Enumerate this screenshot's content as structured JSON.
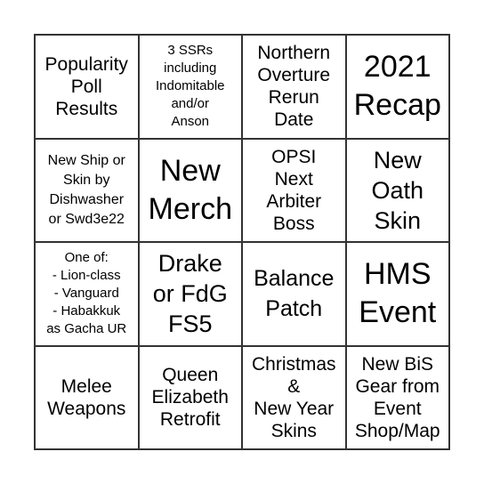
{
  "cells": [
    {
      "text": "Popularity\nPoll\nResults",
      "size": "m"
    },
    {
      "text": "3 SSRs\nincluding\nIndomitable\nand/or\nAnson",
      "size": "s"
    },
    {
      "text": "Northern\nOverture\nRerun\nDate",
      "size": "m"
    },
    {
      "text": "2021\nRecap",
      "size": "xl"
    },
    {
      "text": "New Ship or\nSkin by\nDishwasher\nor Swd3e22",
      "size": "s2"
    },
    {
      "text": "New\nMerch",
      "size": "xl"
    },
    {
      "text": "OPSI\nNext\nArbiter\nBoss",
      "size": "m"
    },
    {
      "text": "New\nOath\nSkin",
      "size": "l"
    },
    {
      "text": "One of:\n- Lion-class\n- Vanguard\n- Habakkuk\nas Gacha UR",
      "size": "s"
    },
    {
      "text": "Drake\nor FdG\nFS5",
      "size": "l"
    },
    {
      "text": "Balance\nPatch",
      "size": "l2"
    },
    {
      "text": "HMS\nEvent",
      "size": "xl"
    },
    {
      "text": "Melee\nWeapons",
      "size": "m"
    },
    {
      "text": "Queen\nElizabeth\nRetrofit",
      "size": "m"
    },
    {
      "text": "Christmas\n&\nNew Year\nSkins",
      "size": "m"
    },
    {
      "text": "New BiS\nGear from\nEvent\nShop/Map",
      "size": "m"
    }
  ]
}
